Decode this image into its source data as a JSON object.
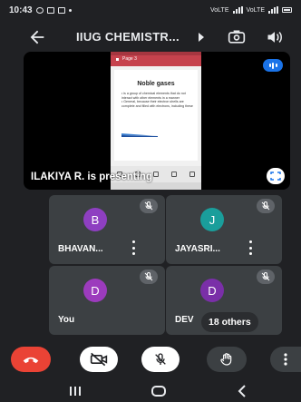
{
  "status_bar": {
    "time": "10:43",
    "network_left": "VoLTE",
    "network_right": "VoLTE"
  },
  "app_bar": {
    "title": "IIUG CHEMISTR...",
    "back_icon": "arrow-left-icon",
    "switch_camera_icon": "switch-camera-icon",
    "audio_output_icon": "speaker-icon"
  },
  "presentation": {
    "presenter_label": "ILAKIYA R. is presenting",
    "slide": {
      "app_header": "Page 3",
      "title": "Noble gases",
      "bullets": [
        "• is a group of chemical elements that do not interact with other elements in a manner",
        "• General, because their electron shells are complete and filled with electrons, including these"
      ]
    }
  },
  "participants": [
    {
      "initial": "B",
      "name": "BHAVAN...",
      "avatar_color": "#8e3fc1",
      "muted": true
    },
    {
      "initial": "J",
      "name": "JAYASRI...",
      "avatar_color": "#1a9e9b",
      "muted": true
    },
    {
      "initial": "D",
      "name": "You",
      "avatar_color": "#9c3bbd",
      "muted": true
    },
    {
      "initial": "D",
      "name": "DEV",
      "avatar_color": "#7a2fa8",
      "muted": true
    }
  ],
  "others_count_label": "18 others",
  "controls": {
    "end_call_color": "#ea4335",
    "items": [
      "end-call",
      "camera-off",
      "mic-off",
      "raise-hand",
      "more-options"
    ]
  },
  "colors": {
    "background": "#202124",
    "tile": "#3c4043",
    "accent": "#1a73e8"
  }
}
